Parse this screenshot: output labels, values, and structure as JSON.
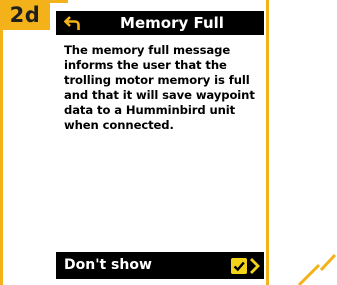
{
  "step_badge": "2d",
  "screen": {
    "title": "Memory Full",
    "message": "The memory full message informs the user that the trolling motor memory is full and that it will save waypoint data to a Humminbird unit when connected.",
    "footer": {
      "label": "Don't show",
      "checked": true
    }
  },
  "icons": {
    "back": "back-arrow-icon",
    "checkbox": "checkbox-checked-icon",
    "chevron": "chevron-right-icon"
  },
  "colors": {
    "accent": "#f3b21a",
    "checkbox": "#f3d21a",
    "bar": "#000000",
    "text_on_bar": "#ffffff"
  }
}
